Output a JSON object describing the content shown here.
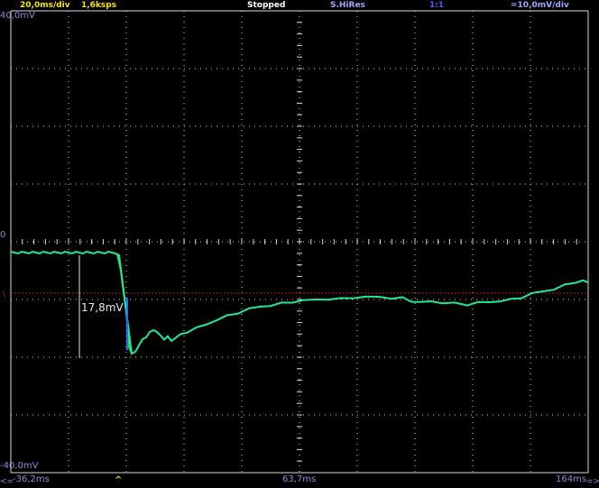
{
  "header": {
    "timebase": "20,0ms/div",
    "sample_rate": "1,6ksps",
    "run_state": "Stopped",
    "acq_mode": "S.HiRes",
    "ratio": "1:1",
    "vertical_scale": "=10,0mV/div"
  },
  "vertical_labels": {
    "top": "40,0mV",
    "zero": "0",
    "bottom": "-40,0mV"
  },
  "time_axis": {
    "left_arrow": "<=",
    "left": "-36,2ms",
    "trigger_marker": "^",
    "center": "63,7ms",
    "right": "164ms",
    "right_arrow": "=>"
  },
  "measurement": {
    "text": "17,8mV"
  },
  "colors": {
    "timebase": "#f5e400",
    "status": "#ffffff",
    "mode": "#9fa8ff",
    "trace": "#22e89a",
    "trace_fall": "#3ad13a",
    "ref_line": "#c02020",
    "grid": "#d8d8d8",
    "axis_text": "#9a86d8"
  }
}
